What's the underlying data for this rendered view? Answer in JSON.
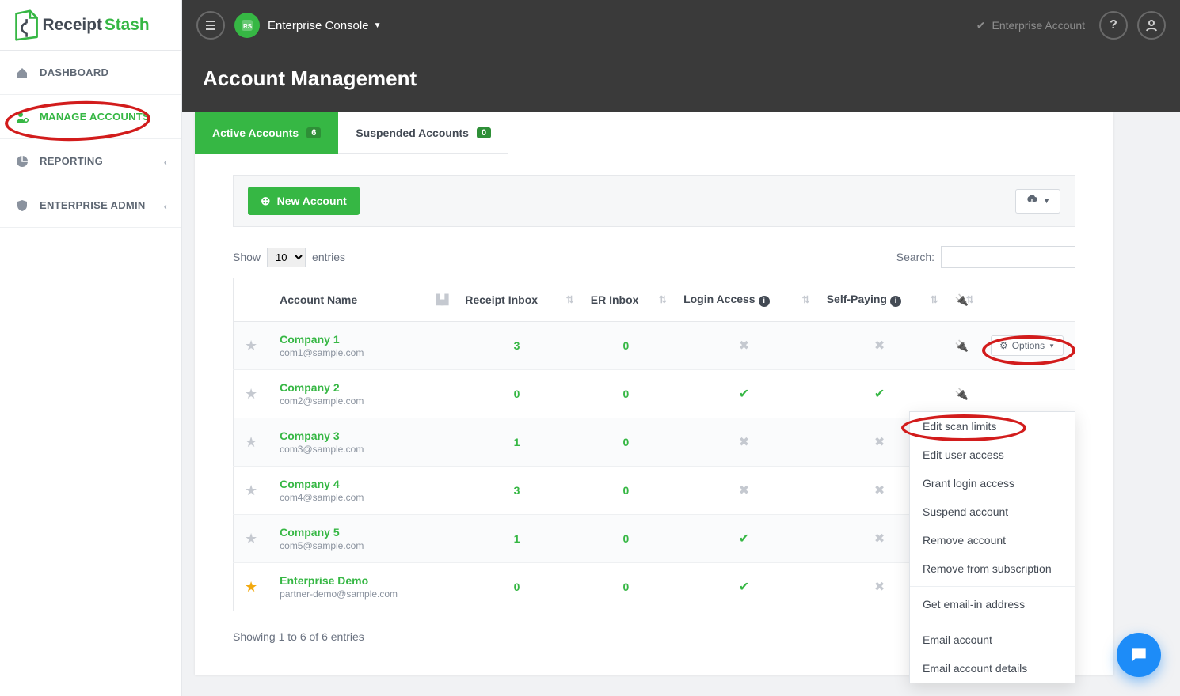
{
  "logo": {
    "text1": "Receipt",
    "text2": "Stash"
  },
  "nav": [
    {
      "label": "DASHBOARD",
      "active": false,
      "expandable": false
    },
    {
      "label": "MANAGE ACCOUNTS",
      "active": true,
      "expandable": false
    },
    {
      "label": "REPORTING",
      "active": false,
      "expandable": true
    },
    {
      "label": "ENTERPRISE ADMIN",
      "active": false,
      "expandable": true
    }
  ],
  "topbar": {
    "console_label": "Enterprise Console",
    "account_label": "Enterprise Account"
  },
  "page_title": "Account Management",
  "tabs": {
    "active": {
      "label": "Active Accounts",
      "count": "6"
    },
    "suspended": {
      "label": "Suspended Accounts",
      "count": "0"
    }
  },
  "toolbar": {
    "new_account": "New Account"
  },
  "table_controls": {
    "show_pre": "Show",
    "show_post": "entries",
    "page_size": "10",
    "search_label": "Search:"
  },
  "columns": {
    "name": "Account Name",
    "receipt": "Receipt Inbox",
    "er": "ER Inbox",
    "login": "Login Access",
    "selfpay": "Self-Paying"
  },
  "rows": [
    {
      "fav": false,
      "name": "Company 1",
      "email": "com1@sample.com",
      "receipt": "3",
      "er": "0",
      "login": false,
      "selfpay": false,
      "show_options": true
    },
    {
      "fav": false,
      "name": "Company 2",
      "email": "com2@sample.com",
      "receipt": "0",
      "er": "0",
      "login": true,
      "selfpay": true,
      "show_options": false
    },
    {
      "fav": false,
      "name": "Company 3",
      "email": "com3@sample.com",
      "receipt": "1",
      "er": "0",
      "login": false,
      "selfpay": false,
      "show_options": false
    },
    {
      "fav": false,
      "name": "Company 4",
      "email": "com4@sample.com",
      "receipt": "3",
      "er": "0",
      "login": false,
      "selfpay": false,
      "show_options": false
    },
    {
      "fav": false,
      "name": "Company 5",
      "email": "com5@sample.com",
      "receipt": "1",
      "er": "0",
      "login": true,
      "selfpay": false,
      "show_options": false
    },
    {
      "fav": true,
      "name": "Enterprise Demo",
      "email": "partner-demo@sample.com",
      "receipt": "0",
      "er": "0",
      "login": true,
      "selfpay": false,
      "show_options": false
    }
  ],
  "options_label": "Options",
  "dropdown": [
    "Edit scan limits",
    "Edit user access",
    "Grant login access",
    "Suspend account",
    "Remove account",
    "Remove from subscription",
    "---",
    "Get email-in address",
    "---",
    "Email account",
    "Email account details"
  ],
  "footer_text": "Showing 1 to 6 of 6 entries"
}
